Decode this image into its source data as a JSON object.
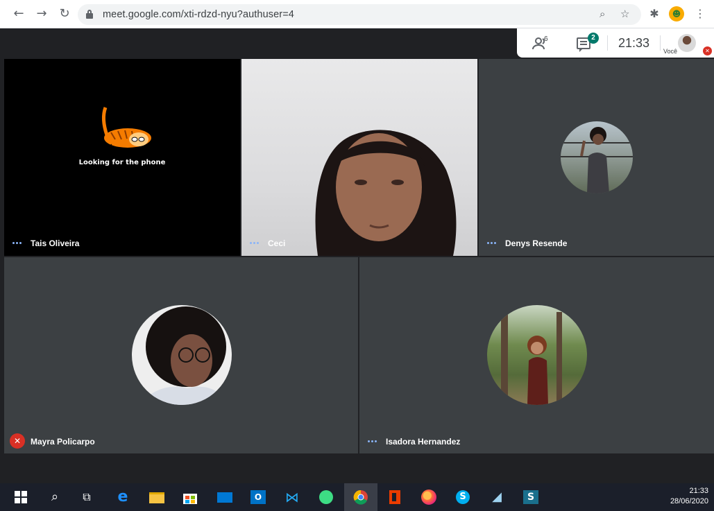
{
  "browser": {
    "url": "meet.google.com/xti-rdzd-nyu?authuser=4",
    "back_icon": "back-arrow-icon",
    "forward_icon": "forward-arrow-icon",
    "reload_icon": "reload-icon"
  },
  "meeting_info": {
    "participants_count": "6",
    "chat_badge": "2",
    "time": "21:33",
    "self_label": "Você"
  },
  "tiles": [
    {
      "name": "Tais Oliveira",
      "caption": "Looking for the phone",
      "audio": "speaking-dots"
    },
    {
      "name": "Ceci",
      "audio": "speaking-dots"
    },
    {
      "name": "Denys Resende",
      "audio": "speaking-dots"
    },
    {
      "name": "Mayra Policarpo",
      "audio": "muted"
    },
    {
      "name": "Isadora Hernandez",
      "audio": "speaking-dots"
    }
  ],
  "taskbar": {
    "time": "21:33",
    "date": "28/06/2020",
    "apps": [
      "start-icon",
      "search-icon",
      "task-view-icon",
      "edge-icon",
      "file-explorer-icon",
      "store-icon",
      "mail-icon",
      "outlook-icon",
      "vscode-icon",
      "android-studio-icon",
      "chrome-icon",
      "office-icon",
      "firefox-icon",
      "skype-icon",
      "notepad-icon",
      "sway-icon"
    ]
  },
  "colors": {
    "meet_bg": "#202124",
    "speaking_dots": "#8ab4f8",
    "muted_red": "#d93025",
    "chat_badge": "#00796b"
  }
}
